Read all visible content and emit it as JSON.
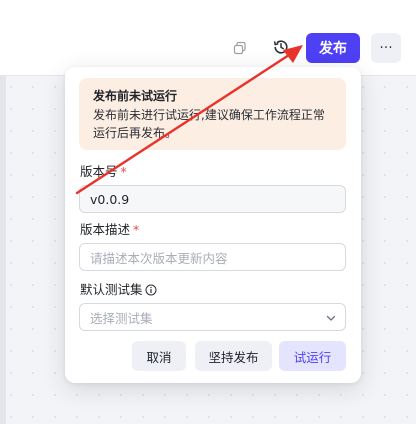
{
  "header": {
    "publish_label": "发布",
    "more_label": "···",
    "icons": [
      "copy-icon",
      "history-icon"
    ]
  },
  "popover": {
    "warning": {
      "title": "发布前未试运行",
      "body": "发布前未进行试运行,建议确保工作流程正常运行后再发布。"
    },
    "version": {
      "label": "版本号",
      "required_mark": "*",
      "value": "v0.0.9"
    },
    "description": {
      "label": "版本描述",
      "required_mark": "*",
      "placeholder": "请描述本次版本更新内容"
    },
    "test_set": {
      "label": "默认测试集",
      "placeholder": "选择测试集"
    },
    "buttons": {
      "cancel": "取消",
      "force_publish": "坚持发布",
      "test_run": "试运行"
    }
  },
  "colors": {
    "accent": "#4e40f5",
    "warning_bg": "#fdeee3",
    "required": "#e5484d",
    "annotation_arrow": "#e8322a"
  }
}
